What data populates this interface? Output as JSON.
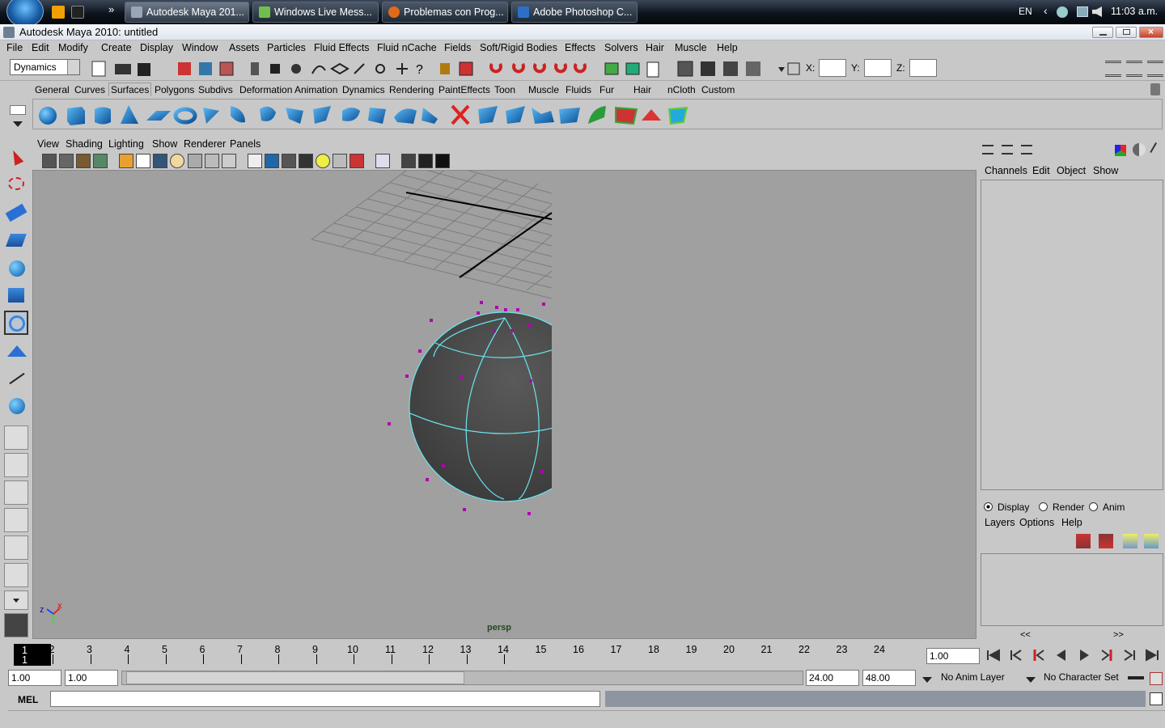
{
  "taskbar": {
    "tasks": [
      {
        "label": "Autodesk Maya 201...",
        "color": "#9aa6b5"
      },
      {
        "label": "Windows Live Mess...",
        "color": "#6fbf4a"
      },
      {
        "label": "Problemas con Prog...",
        "color": "#e06a1a"
      },
      {
        "label": "Adobe Photoshop C...",
        "color": "#2c6fc8"
      }
    ],
    "overflow": "»",
    "lang": "EN",
    "tray_chevron": "‹",
    "clock": "11:03 a.m."
  },
  "window": {
    "title": "Autodesk Maya 2010: untitled"
  },
  "menubar": [
    "File",
    "Edit",
    "Modify",
    "Create",
    "Display",
    "Window",
    "Assets",
    "Particles",
    "Fluid Effects",
    "Fluid nCache",
    "Fields",
    "Soft/Rigid Bodies",
    "Effects",
    "Solvers",
    "Hair",
    "Muscle",
    "Help"
  ],
  "statusline": {
    "menuset": "Dynamics",
    "x_label": "X:",
    "y_label": "Y:",
    "z_label": "Z:"
  },
  "shelf": {
    "tabs": [
      "General",
      "Curves",
      "Surfaces",
      "Polygons",
      "Subdivs",
      "Deformation",
      "Animation",
      "Dynamics",
      "Rendering",
      "PaintEffects",
      "Toon",
      "Muscle",
      "Fluids",
      "Fur",
      "Hair",
      "nCloth",
      "Custom"
    ],
    "active_tab": "Surfaces"
  },
  "panel": {
    "menu": [
      "View",
      "Shading",
      "Lighting",
      "Show",
      "Renderer",
      "Panels"
    ],
    "camera_label": "persp",
    "axis_z": "z",
    "axis_x": "x"
  },
  "channel_box": {
    "menu": [
      "Channels",
      "Edit",
      "Object",
      "Show"
    ]
  },
  "layer_editor": {
    "modes": [
      "Display",
      "Render",
      "Anim"
    ],
    "active_mode": "Display",
    "menu": [
      "Layers",
      "Options",
      "Help"
    ],
    "scroll_left": "<<",
    "scroll_right": ">>"
  },
  "timeline": {
    "current_frame": "1",
    "ticks": [
      "2",
      "3",
      "4",
      "5",
      "6",
      "7",
      "8",
      "9",
      "10",
      "11",
      "12",
      "13",
      "14",
      "15",
      "16",
      "17",
      "18",
      "19",
      "20",
      "21",
      "22",
      "23",
      "24"
    ],
    "current_time": "1.00"
  },
  "range": {
    "start": "1.00",
    "playback_start": "1.00",
    "playback_end": "24.00",
    "end": "48.00",
    "anim_layer": "No Anim Layer",
    "character_set": "No Character Set"
  },
  "command_line": {
    "label": "MEL"
  }
}
